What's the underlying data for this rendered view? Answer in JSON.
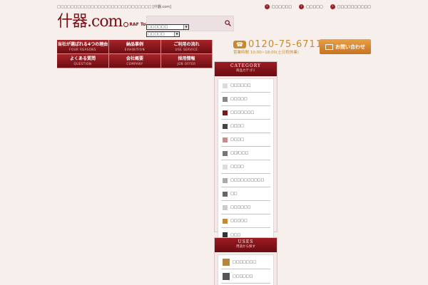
{
  "header": {
    "tagline": "□□□□□□□□□□□□□□□□□□□□□□□□□□□□ [什器.com]",
    "toplinks": [
      {
        "label": "□□□□□□"
      },
      {
        "label": "□□□□□"
      },
      {
        "label": "□□□□□□□□□□"
      }
    ],
    "logo": {
      "main": "什器.com",
      "sub": "RAF Tokyo"
    },
    "search": {
      "placeholder": ""
    },
    "select1": "□□□□□□",
    "select2": "□□□□□"
  },
  "nav": [
    {
      "jp": "当社が選ばれる4つの理由",
      "en": "FOUR REASONS"
    },
    {
      "jp": "納品事例",
      "en": "EXHIBITION"
    },
    {
      "jp": "ご利用の流れ",
      "en": "USE SERVICE"
    },
    {
      "jp": "よくある質問",
      "en": "QUESTION"
    },
    {
      "jp": "会社概要",
      "en": "COMPANY"
    },
    {
      "jp": "採用情報",
      "en": "JOB OFFER"
    }
  ],
  "phone": {
    "icon_text": "☎",
    "number": "0120-75-6711",
    "hours": "営業時間 10:00~18:00(土日祝休業)"
  },
  "contact": {
    "label": "お問い合わせ"
  },
  "category": {
    "title": "CATEGORY",
    "subtitle": "商品カテゴリ",
    "items": [
      {
        "label": "□□□□□□",
        "color": "#dcdcdc"
      },
      {
        "label": "□□□□□",
        "color": "#888888"
      },
      {
        "label": "□□□□□□□",
        "color": "#7a1a1a"
      },
      {
        "label": "□□□□",
        "color": "#444444"
      },
      {
        "label": "□□□□",
        "color": "#c88a8a"
      },
      {
        "label": "□□/□□□",
        "color": "#777777"
      },
      {
        "label": "□□□□",
        "color": "#dddddd"
      },
      {
        "label": "□□□□□□□□□□",
        "color": "#aaaaaa"
      },
      {
        "label": "□□",
        "color": "#666666"
      },
      {
        "label": "□□□□□□",
        "color": "#cccccc"
      },
      {
        "label": "□□□□□",
        "color": "#c8892c"
      },
      {
        "label": "□□□",
        "color": "#333333"
      }
    ]
  },
  "uses": {
    "title": "USES",
    "subtitle": "用途から探す",
    "items": [
      {
        "label": "□□□□□□□",
        "color": "#b8863a"
      },
      {
        "label": "□□□□□□",
        "color": "#555555"
      },
      {
        "label": "□□□□□",
        "color": "#8a6a4a"
      }
    ]
  }
}
